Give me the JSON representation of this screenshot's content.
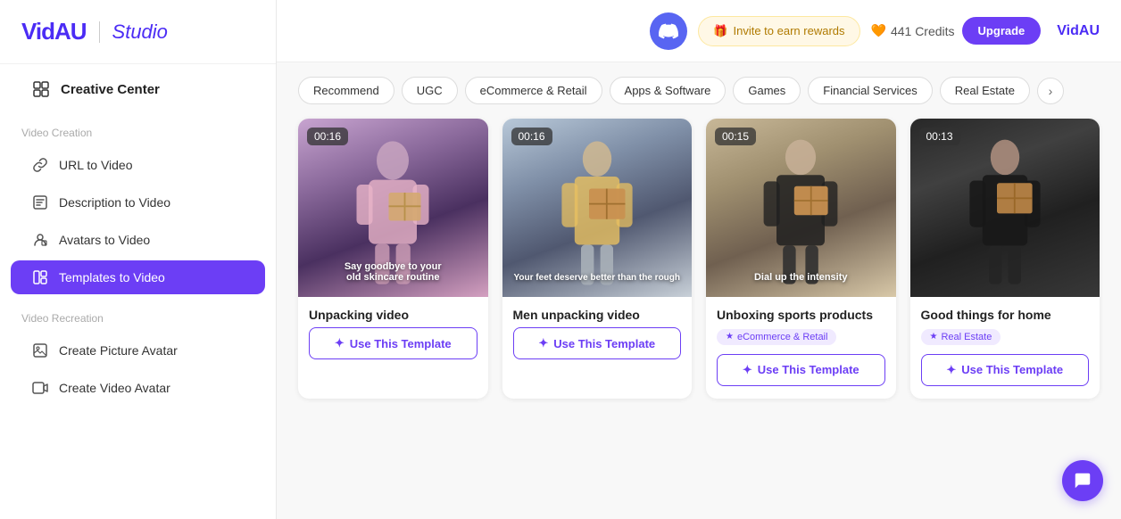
{
  "logo": {
    "vid": "VidAU",
    "studio": "Studio",
    "brand": "VidAU"
  },
  "sidebar": {
    "creative_center_label": "Creative Center",
    "video_creation_section": "Video Creation",
    "video_recreation_section": "Video Recreation",
    "items": [
      {
        "id": "url-to-video",
        "label": "URL to Video"
      },
      {
        "id": "description-to-video",
        "label": "Description to Video"
      },
      {
        "id": "avatars-to-video",
        "label": "Avatars to Video"
      },
      {
        "id": "templates-to-video",
        "label": "Templates to Video",
        "active": true
      },
      {
        "id": "create-picture-avatar",
        "label": "Create Picture Avatar"
      },
      {
        "id": "create-video-avatar",
        "label": "Create Video Avatar"
      }
    ]
  },
  "topbar": {
    "invite_label": "Invite to earn rewards",
    "credits_label": "441 Credits",
    "upgrade_label": "Upgrade",
    "brand_label": "VidAU"
  },
  "filter_tabs": [
    {
      "id": "recommend",
      "label": "Recommend",
      "active": false
    },
    {
      "id": "ugc",
      "label": "UGC",
      "active": false
    },
    {
      "id": "ecommerce",
      "label": "eCommerce & Retail",
      "active": false
    },
    {
      "id": "apps",
      "label": "Apps & Software",
      "active": false
    },
    {
      "id": "games",
      "label": "Games",
      "active": false
    },
    {
      "id": "financial",
      "label": "Financial Services",
      "active": false
    },
    {
      "id": "realestate",
      "label": "Real Estate",
      "active": false
    }
  ],
  "cards": [
    {
      "id": "card-1",
      "duration": "00:16",
      "title": "Unpacking video",
      "tag": null,
      "caption": "Say goodbye to your old skincare routine",
      "btn_label": "Use This Template",
      "thumb_class": "thumb-1"
    },
    {
      "id": "card-2",
      "duration": "00:16",
      "title": "Men unpacking video",
      "tag": null,
      "caption": "Your feet deserve better than the rough",
      "btn_label": "Use This Template",
      "thumb_class": "thumb-2"
    },
    {
      "id": "card-3",
      "duration": "00:15",
      "title": "Unboxing sports products",
      "tag": "eCommerce & Retail",
      "caption": "Dial up the intensity",
      "btn_label": "Use This Template",
      "thumb_class": "thumb-3"
    },
    {
      "id": "card-4",
      "duration": "00:13",
      "title": "Good things for home",
      "tag": "Real Estate",
      "caption": "",
      "btn_label": "Use This Template",
      "thumb_class": "thumb-4"
    }
  ]
}
